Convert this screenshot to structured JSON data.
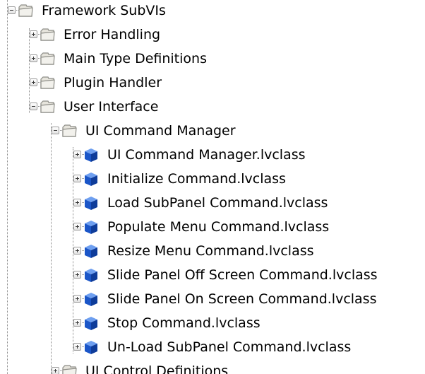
{
  "tree": {
    "nodes": [
      {
        "label": "Framework SubVIs",
        "level": 0,
        "icon": "folder-icon",
        "expanded": true
      },
      {
        "label": "Error Handling",
        "level": 1,
        "icon": "folder-icon",
        "expanded": false
      },
      {
        "label": "Main Type Definitions",
        "level": 1,
        "icon": "folder-icon",
        "expanded": false
      },
      {
        "label": "Plugin Handler",
        "level": 1,
        "icon": "folder-icon",
        "expanded": false
      },
      {
        "label": "User Interface",
        "level": 1,
        "icon": "folder-icon",
        "expanded": true
      },
      {
        "label": "UI Command Manager",
        "level": 2,
        "icon": "folder-icon",
        "expanded": true
      },
      {
        "label": "UI Command Manager.lvclass",
        "level": 3,
        "icon": "lvclass-cube-icon",
        "expanded": false
      },
      {
        "label": "Initialize Command.lvclass",
        "level": 3,
        "icon": "lvclass-cube-icon",
        "expanded": false
      },
      {
        "label": "Load SubPanel Command.lvclass",
        "level": 3,
        "icon": "lvclass-cube-icon",
        "expanded": false
      },
      {
        "label": "Populate Menu Command.lvclass",
        "level": 3,
        "icon": "lvclass-cube-icon",
        "expanded": false
      },
      {
        "label": "Resize Menu Command.lvclass",
        "level": 3,
        "icon": "lvclass-cube-icon",
        "expanded": false
      },
      {
        "label": "Slide Panel Off Screen Command.lvclass",
        "level": 3,
        "icon": "lvclass-cube-icon",
        "expanded": false
      },
      {
        "label": "Slide Panel On Screen Command.lvclass",
        "level": 3,
        "icon": "lvclass-cube-icon",
        "expanded": false
      },
      {
        "label": "Stop Command.lvclass",
        "level": 3,
        "icon": "lvclass-cube-icon",
        "expanded": false
      },
      {
        "label": "Un-Load SubPanel Command.lvclass",
        "level": 3,
        "icon": "lvclass-cube-icon",
        "expanded": false
      },
      {
        "label": "UI Control Definitions",
        "level": 2,
        "icon": "folder-icon",
        "expanded": false
      }
    ]
  },
  "colors": {
    "background": "#ffffff",
    "text": "#000000",
    "tree_line": "#8a8a8a",
    "folder_fill": "#e6e4dc",
    "folder_stroke": "#8c8c86",
    "class_cube": "#1b56c8"
  }
}
